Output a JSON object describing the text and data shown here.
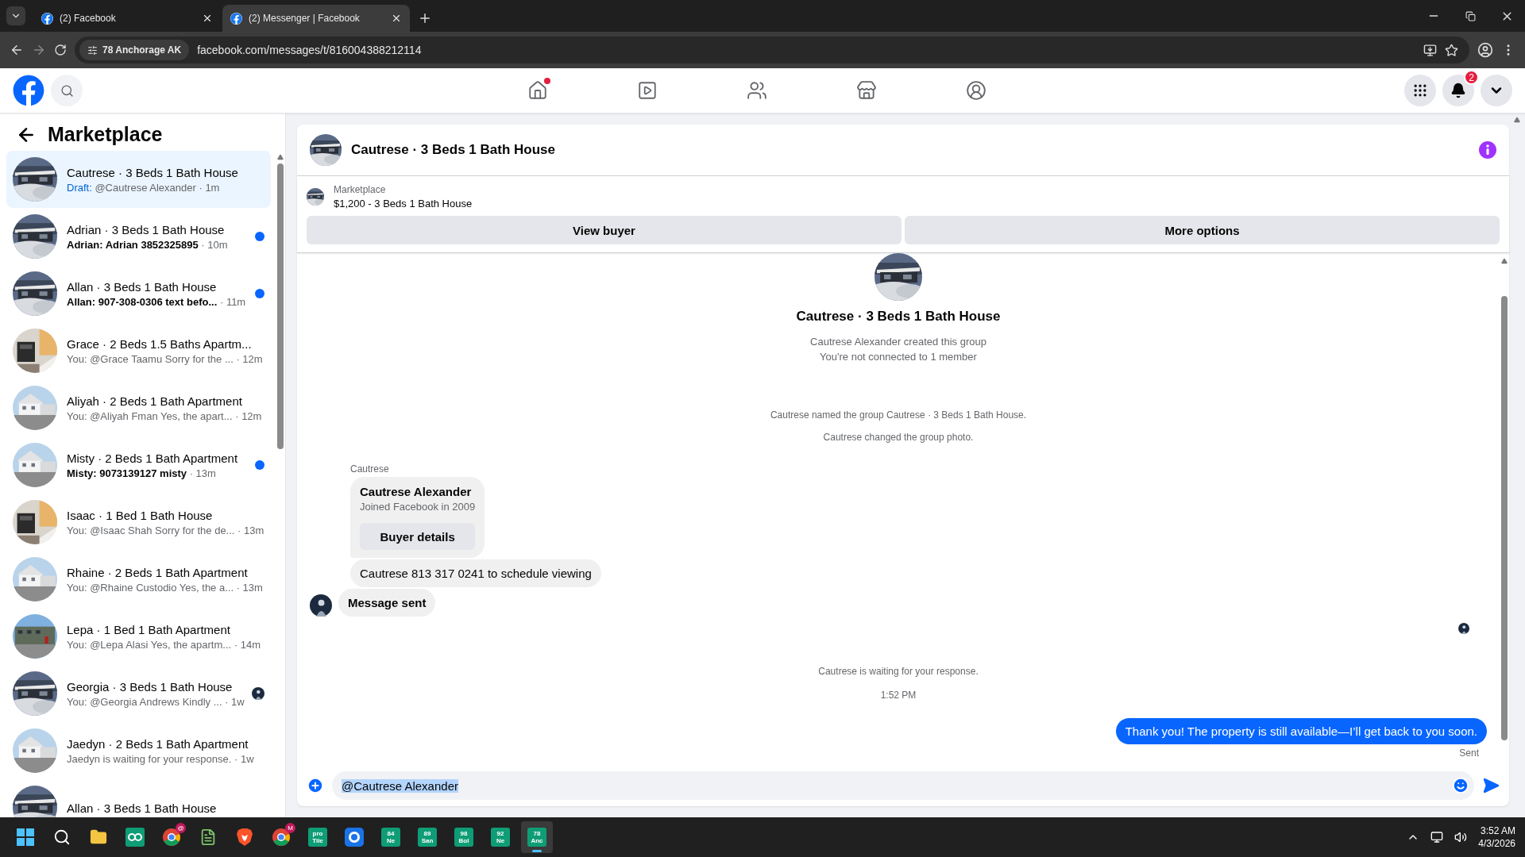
{
  "browser": {
    "tabs": [
      {
        "title": "(2) Facebook",
        "selected": false
      },
      {
        "title": "(2) Messenger | Facebook",
        "selected": true
      }
    ],
    "site_chip": "78 Anchorage AK",
    "url": "facebook.com/messages/t/816004388212114"
  },
  "header": {
    "nav": [
      {
        "kind": "home",
        "dot": true
      },
      {
        "kind": "video",
        "dot": false
      },
      {
        "kind": "friends",
        "dot": false
      },
      {
        "kind": "marketplace",
        "dot": false
      },
      {
        "kind": "groups",
        "dot": false
      }
    ],
    "notification_count": "2"
  },
  "sidebar": {
    "title": "Marketplace",
    "conversations": [
      {
        "title": "Cautrese · 3 Beds 1 Bath House",
        "draft": "Draft:",
        "preview": "@Cautrese Alexander",
        "time": "· 1m",
        "unread": false,
        "selected": true,
        "seen_avatar": false
      },
      {
        "title": "Adrian · 3 Beds 1 Bath House",
        "preview": "Adrian: Adrian 3852325895",
        "time": "· 10m",
        "unread": true,
        "selected": false,
        "seen_avatar": false
      },
      {
        "title": "Allan · 3 Beds 1 Bath House",
        "preview": "Allan: 907-308-0306 text befo...",
        "time": "· 11m",
        "unread": true,
        "selected": false,
        "seen_avatar": false
      },
      {
        "title": "Grace · 2 Beds 1.5 Baths Apartm...",
        "preview": "You: @Grace Taamu Sorry for the ...",
        "time": "· 12m",
        "unread": false,
        "selected": false,
        "seen_avatar": false
      },
      {
        "title": "Aliyah · 2 Beds 1 Bath Apartment",
        "preview": "You: @Aliyah Fman Yes, the apart...",
        "time": "· 12m",
        "unread": false,
        "selected": false,
        "seen_avatar": false
      },
      {
        "title": "Misty · 2 Beds 1 Bath Apartment",
        "preview": "Misty: 9073139127 misty",
        "time": "· 13m",
        "unread": true,
        "selected": false,
        "seen_avatar": false
      },
      {
        "title": "Isaac · 1 Bed 1 Bath House",
        "preview": "You: @Isaac Shah Sorry for the de...",
        "time": "· 13m",
        "unread": false,
        "selected": false,
        "seen_avatar": false
      },
      {
        "title": "Rhaine · 2 Beds 1 Bath Apartment",
        "preview": "You: @Rhaine Custodio Yes, the a...",
        "time": "· 13m",
        "unread": false,
        "selected": false,
        "seen_avatar": false
      },
      {
        "title": "Lepa · 1 Bed 1 Bath Apartment",
        "preview": "You: @Lepa Alasi Yes, the apartm...",
        "time": "· 14m",
        "unread": false,
        "selected": false,
        "seen_avatar": false
      },
      {
        "title": "Georgia · 3 Beds 1 Bath House",
        "preview": "You: @Georgia Andrews Kindly ...",
        "time": "· 1w",
        "unread": false,
        "selected": false,
        "seen_avatar": true
      },
      {
        "title": "Jaedyn · 2 Beds 1 Bath Apartment",
        "preview": "Jaedyn is waiting for your response.",
        "time": "· 1w",
        "unread": false,
        "selected": false,
        "seen_avatar": false
      },
      {
        "title": "Allan · 3 Beds 1 Bath House",
        "selected": false
      }
    ]
  },
  "chat": {
    "title": "Cautrese · 3 Beds 1 Bath House",
    "listing": {
      "label": "Marketplace",
      "title": "$1,200 - 3 Beds 1 Bath House"
    },
    "actions": [
      "View buyer",
      "More options"
    ],
    "intro": {
      "title": "Cautrese · 3 Beds 1 Bath House",
      "lines": [
        "Cautrese Alexander created this group",
        "You're not connected to 1 member"
      ]
    },
    "messages": [
      {
        "kind": "system",
        "text": "Cautrese named the group Cautrese · 3 Beds 1 Bath House."
      },
      {
        "kind": "system",
        "text": "Cautrese changed the group photo."
      },
      {
        "kind": "sender",
        "text": "Cautrese"
      },
      {
        "kind": "profile_card",
        "name": "Cautrese Alexander",
        "detail": "Joined Facebook in 2009",
        "button": "Buyer details"
      },
      {
        "kind": "incoming",
        "text": "Cautrese 813 317 0241 to schedule viewing"
      },
      {
        "kind": "incoming_last",
        "text": "Message sent"
      },
      {
        "kind": "read_receipt"
      },
      {
        "kind": "system",
        "text": "Cautrese is waiting for your response."
      },
      {
        "kind": "timestamp",
        "text": "1:52 PM"
      },
      {
        "kind": "outgoing",
        "text": "Thank you! The property is still available—I’ll get back to you soon.",
        "status": "Sent"
      }
    ],
    "composer": {
      "value": "@Cautrese Alexander"
    }
  },
  "taskbar": {
    "apps": [
      {
        "kind": "search",
        "selected": false
      },
      {
        "kind": "folder",
        "selected": false
      },
      {
        "kind": "qo",
        "selected": false
      },
      {
        "kind": "chrome",
        "badge": "@",
        "selected": false
      },
      {
        "kind": "notepad",
        "selected": false
      },
      {
        "kind": "brave",
        "selected": false
      },
      {
        "kind": "chrome",
        "badge": "M",
        "selected": false
      },
      {
        "kind": "tile",
        "lines": [
          "pro",
          "Tile"
        ],
        "selected": false
      },
      {
        "kind": "circle",
        "selected": false
      },
      {
        "kind": "tile",
        "lines": [
          "84",
          "Ne"
        ],
        "selected": false
      },
      {
        "kind": "tile",
        "lines": [
          "89",
          "San"
        ],
        "selected": false
      },
      {
        "kind": "tile",
        "lines": [
          "98",
          "Bol"
        ],
        "selected": false
      },
      {
        "kind": "tile",
        "lines": [
          "92",
          "Ne"
        ],
        "selected": false
      },
      {
        "kind": "tile",
        "lines": [
          "78",
          "Anc"
        ],
        "selected": true
      }
    ],
    "clock": {
      "time": "3:52 AM",
      "date": "4/3/2026"
    }
  }
}
